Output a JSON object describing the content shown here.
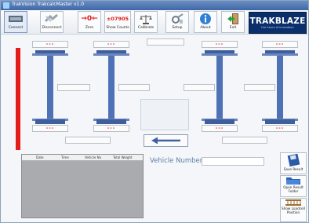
{
  "window": {
    "title": "TrakVision TrakcalcMaster v1.0"
  },
  "toolbar": {
    "connect": "Connect",
    "disconnect": "Disconnect",
    "zero": "Zero",
    "zero_symbol": "→0←",
    "show_counts": "Show Counts",
    "show_counts_value": "±07905",
    "calibrate": "Calibrate",
    "setup": "Setup",
    "about": "About",
    "exit": "Exit"
  },
  "logo": {
    "name": "TRAKBLAZE",
    "tagline": "the future of innovation"
  },
  "weighbeams": {
    "dash": "---",
    "count": 4
  },
  "table": {
    "columns": [
      "Date",
      "Time",
      "Vehicle No",
      "Total Weight"
    ]
  },
  "vehicle": {
    "label": "Vehicle Number",
    "value": ""
  },
  "sidebuttons": {
    "save": "Save Result",
    "open": "Open Result Folder",
    "show": "Show Loadcell Position"
  },
  "colors": {
    "accent": "#4a6fb5",
    "red": "#e31c1c",
    "title_bar": "#3f67a6"
  }
}
